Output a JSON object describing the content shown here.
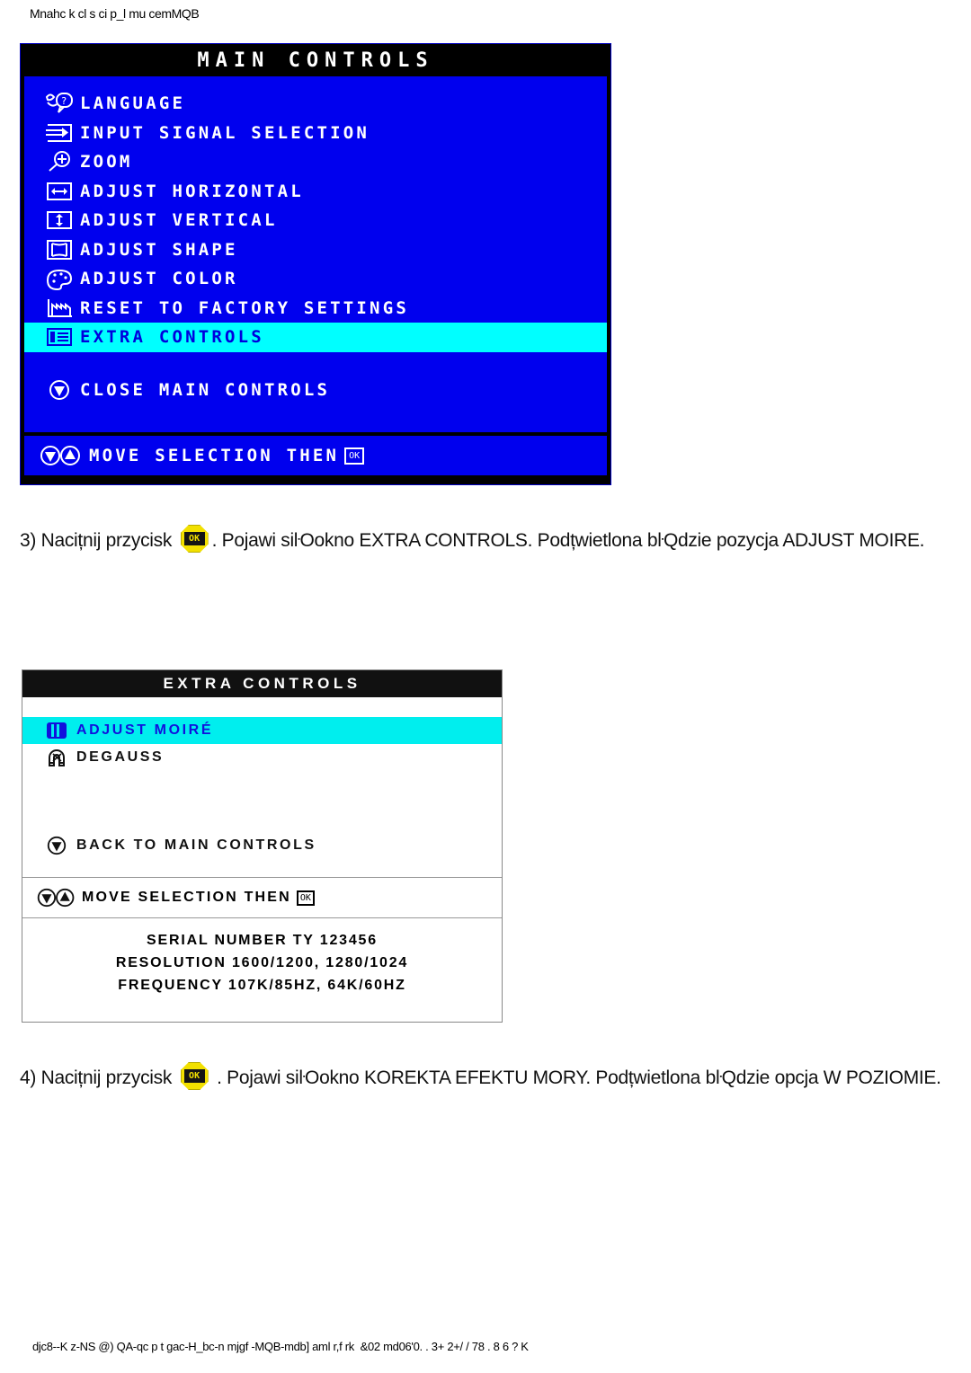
{
  "page_header": "Mnahc k cl s ci p_l mu cemMQB",
  "page_footer": "djc8--K z-NS @) QA-qc p t gac-H_bc-n mjgf -MQB-mdb] aml r,f rk  &02 md06'0. . 3+ 2+/ / 78 . 8 6 ? K",
  "osd_main": {
    "title": "MAIN CONTROLS",
    "items": [
      {
        "icon": "language-globe-icon",
        "label": "LANGUAGE",
        "highlight": false
      },
      {
        "icon": "input-signal-arrow-icon",
        "label": "INPUT SIGNAL SELECTION",
        "highlight": false
      },
      {
        "icon": "zoom-magnifier-icon",
        "label": "ZOOM",
        "highlight": false
      },
      {
        "icon": "adjust-horizontal-icon",
        "label": "ADJUST HORIZONTAL",
        "highlight": false
      },
      {
        "icon": "adjust-vertical-icon",
        "label": "ADJUST VERTICAL",
        "highlight": false
      },
      {
        "icon": "adjust-shape-icon",
        "label": "ADJUST SHAPE",
        "highlight": false
      },
      {
        "icon": "adjust-color-palette-icon",
        "label": "ADJUST COLOR",
        "highlight": false
      },
      {
        "icon": "reset-factory-icon",
        "label": "RESET TO FACTORY SETTINGS",
        "highlight": false
      },
      {
        "icon": "extra-controls-list-icon",
        "label": "EXTRA CONTROLS",
        "highlight": true
      }
    ],
    "close_item": {
      "icon": "down-arrow-circle-icon",
      "label": "CLOSE MAIN CONTROLS"
    },
    "footer": {
      "icons": "down-up-arrow-circles-icon",
      "label": "MOVE SELECTION THEN",
      "key": "OK"
    },
    "colors": {
      "background": "#0000ee",
      "title_bar": "#000000",
      "highlight": "#00ffff",
      "highlight_text": "#0000dd",
      "text": "#ffffff"
    }
  },
  "osd_extra": {
    "title": "EXTRA CONTROLS",
    "items": [
      {
        "icon": "moire-pattern-icon",
        "label": "ADJUST MOIRÉ",
        "highlight": true
      },
      {
        "icon": "degauss-magnet-icon",
        "label": "DEGAUSS",
        "highlight": false
      }
    ],
    "back_item": {
      "icon": "down-arrow-circle-icon",
      "label": "BACK TO MAIN CONTROLS"
    },
    "footer": {
      "icons": "down-up-arrow-circles-icon",
      "label": "MOVE SELECTION THEN",
      "key": "OK"
    },
    "info": [
      "SERIAL NUMBER TY 123456",
      "RESOLUTION 1600/1200, 1280/1024",
      "FREQUENCY 107K/85HZ, 64K/60HZ"
    ],
    "colors": {
      "background": "#ffffff",
      "title_bar": "#111111",
      "highlight": "#00eeee",
      "highlight_text": "#1111dd",
      "text": "#111111"
    }
  },
  "paragraphs": {
    "step3": {
      "prefix": "3) Nacițnij przycisk ",
      "button": "OK",
      "suffix": ". Pojawi siŀOokno EXTRA CONTROLS. Podțwietlona bŀQdzie pozycja ADJUST MOIRE."
    },
    "step4": {
      "prefix": "4) Nacițnij przycisk ",
      "button": "OK",
      "suffix": " . Pojawi siŀOokno KOREKTA EFEKTU MORY. Podțwietlona bŀQdzie opcja W POZIOMIE."
    }
  }
}
